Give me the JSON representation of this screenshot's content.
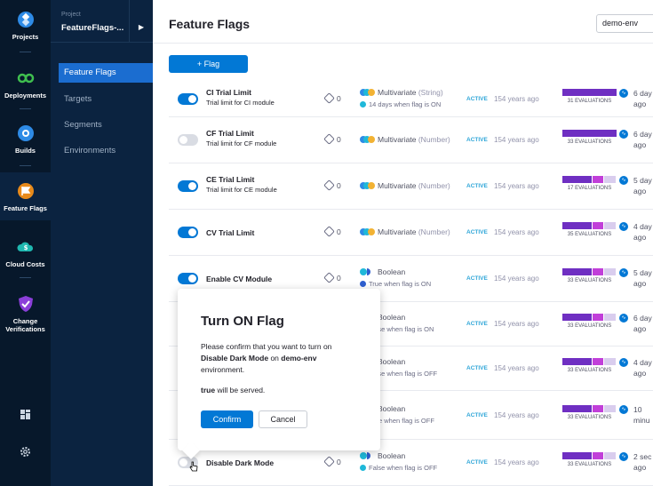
{
  "nav": {
    "items": [
      {
        "label": "Projects",
        "icon": "projects-icon"
      },
      {
        "label": "Deployments",
        "icon": "deployments-icon"
      },
      {
        "label": "Builds",
        "icon": "builds-icon"
      },
      {
        "label": "Feature Flags",
        "icon": "feature-flags-icon"
      },
      {
        "label": "Cloud Costs",
        "icon": "cloud-costs-icon"
      },
      {
        "label": "Change",
        "label2": "Verifications",
        "icon": "change-verifications-icon"
      }
    ],
    "bottom_icons": [
      "dashboard-grid-icon",
      "settings-gear-icon"
    ]
  },
  "project": {
    "label": "Project",
    "name": "FeatureFlags-...",
    "menu": [
      "Feature Flags",
      "Targets",
      "Segments",
      "Environments"
    ]
  },
  "header": {
    "title": "Feature Flags",
    "environment": "demo-env",
    "add_button": "+ Flag"
  },
  "colors": {
    "brand_blue": "#0278d5",
    "nav_bg": "#07182b",
    "sidebar_bg": "#0b2340",
    "eval_purple": "#6f2fc2",
    "eval_magenta": "#c13fd9",
    "eval_light": "#d9cdee",
    "active_status": "#2fa6d8"
  },
  "flags": [
    {
      "name": "CI Trial Limit",
      "desc": "Trial limit for CI module",
      "enabled": true,
      "tags": "0",
      "type": "Multivariate",
      "subtype": "(String)",
      "variation_note": "14 days when flag is ON",
      "status": "ACTIVE",
      "modified": "154 years ago",
      "evaluations": "31 EVALUATIONS",
      "last": "6 day",
      "last2": "ago",
      "bar": [
        1.0,
        0,
        0
      ]
    },
    {
      "name": "CF Trial Limit",
      "desc": "Trial limit for CF module",
      "enabled": false,
      "tags": "0",
      "type": "Multivariate",
      "subtype": "(Number)",
      "variation_note": "",
      "status": "ACTIVE",
      "modified": "154 years ago",
      "evaluations": "33 EVALUATIONS",
      "last": "6 day",
      "last2": "ago",
      "bar": [
        1.0,
        0,
        0
      ]
    },
    {
      "name": "CE Trial Limit",
      "desc": "Trial limit for CE module",
      "enabled": true,
      "tags": "0",
      "type": "Multivariate",
      "subtype": "(Number)",
      "variation_note": "",
      "status": "ACTIVE",
      "modified": "154 years ago",
      "evaluations": "17 EVALUATIONS",
      "last": "5 day",
      "last2": "ago",
      "bar": [
        0.56,
        0.22,
        0.22
      ]
    },
    {
      "name": "CV Trial Limit",
      "desc": "",
      "enabled": true,
      "tags": "0",
      "type": "Multivariate",
      "subtype": "(Number)",
      "variation_note": "",
      "status": "ACTIVE",
      "modified": "154 years ago",
      "evaluations": "35 EVALUATIONS",
      "last": "4 day",
      "last2": "ago",
      "bar": [
        0.56,
        0.22,
        0.22
      ]
    },
    {
      "name": "Enable CV Module",
      "desc": "",
      "enabled": true,
      "tags": "0",
      "type": "Boolean",
      "subtype": "",
      "variation_note": "True when flag is ON",
      "status": "ACTIVE",
      "modified": "154 years ago",
      "evaluations": "33 EVALUATIONS",
      "last": "5 day",
      "last2": "ago",
      "bar": [
        0.56,
        0.22,
        0.22
      ]
    },
    {
      "name": "",
      "desc": "",
      "enabled": true,
      "tags": "",
      "type": "Boolean",
      "subtype": "",
      "variation_note": "False when flag is ON",
      "status": "ACTIVE",
      "modified": "154 years ago",
      "evaluations": "33 EVALUATIONS",
      "last": "6 day",
      "last2": "ago",
      "bar": [
        0.56,
        0.22,
        0.22
      ]
    },
    {
      "name": "",
      "desc": "",
      "enabled": true,
      "tags": "",
      "type": "Boolean",
      "subtype": "",
      "variation_note": "False when flag is OFF",
      "status": "ACTIVE",
      "modified": "154 years ago",
      "evaluations": "33 EVALUATIONS",
      "last": "4 day",
      "last2": "ago",
      "bar": [
        0.56,
        0.22,
        0.22
      ]
    },
    {
      "name": "",
      "desc": "",
      "enabled": true,
      "tags": "",
      "type": "Boolean",
      "subtype": "",
      "variation_note": "True when flag is OFF",
      "status": "ACTIVE",
      "modified": "154 years ago",
      "evaluations": "33 EVALUATIONS",
      "last": "10",
      "last2": "minu",
      "bar": [
        0.56,
        0.22,
        0.22
      ]
    },
    {
      "name": "Disable Dark Mode",
      "desc": "",
      "enabled": false,
      "tags": "0",
      "type": "Boolean",
      "subtype": "",
      "variation_note": "False when flag is OFF",
      "status": "ACTIVE",
      "modified": "154 years ago",
      "evaluations": "33 EVALUATIONS",
      "last": "2 sec",
      "last2": "ago",
      "bar": [
        0.56,
        0.22,
        0.22
      ]
    }
  ],
  "dialog": {
    "title": "Turn ON Flag",
    "body_prefix": "Please confirm that you want to turn on",
    "flag_name": "Disable Dark Mode",
    "body_on": "on",
    "env_name": "demo-env",
    "body_suffix": "environment.",
    "served_value": "true",
    "served_suffix": "will be served.",
    "confirm_label": "Confirm",
    "cancel_label": "Cancel"
  }
}
